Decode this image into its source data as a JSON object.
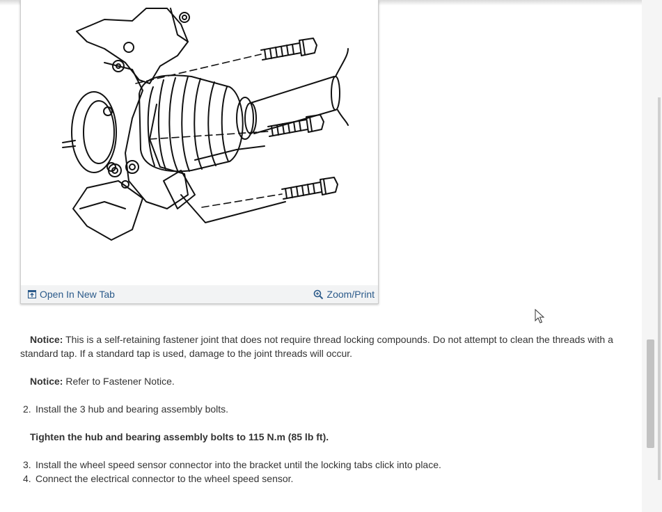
{
  "figure": {
    "open_new_tab_label": "Open In New Tab",
    "zoom_print_label": "Zoom/Print"
  },
  "content": {
    "notice_label": "Notice:",
    "notice_1_text": " This is a self-retaining fastener joint that does not require thread locking compounds. Do not attempt to clean the threads with a standard tap. If a standard tap is used, damage to the joint threads will occur.",
    "notice_2_text": " Refer to Fastener Notice.",
    "steps": [
      {
        "number": "2.",
        "text": "Install the 3 hub and bearing assembly bolts."
      },
      {
        "number": "3.",
        "text": "Install the wheel speed sensor connector into the bracket until the locking tabs click into place."
      },
      {
        "number": "4.",
        "text": "Connect the electrical connector to the wheel speed sensor."
      }
    ],
    "tighten_text": "Tighten the hub and bearing assembly bolts to 115 N.m (85 lb ft)."
  },
  "colors": {
    "link": "#2b5a8a",
    "text": "#333333",
    "scroll_thumb": "#c2c2c2"
  }
}
